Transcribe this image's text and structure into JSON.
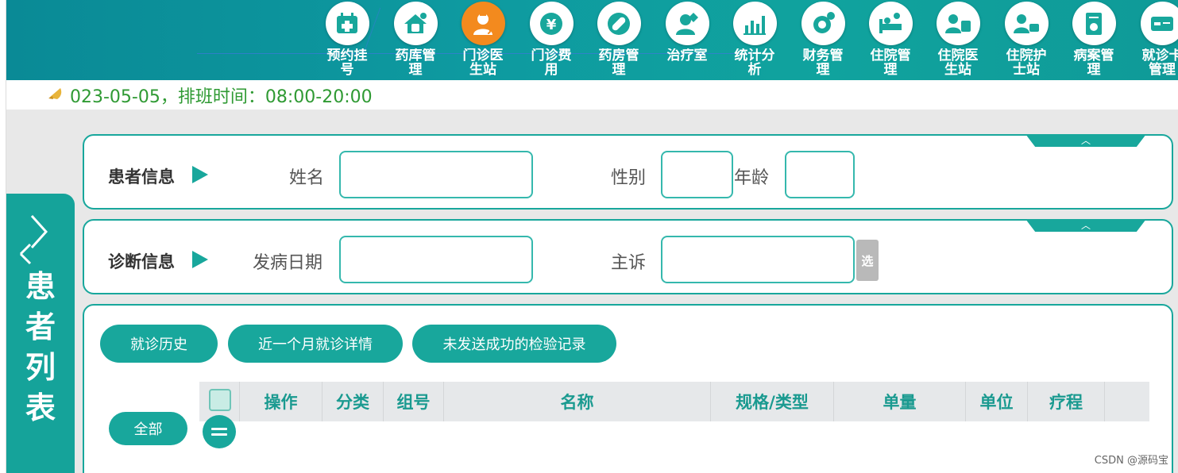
{
  "nav": {
    "items": [
      {
        "label": "预约挂号",
        "icon": "calendar-plus-icon"
      },
      {
        "label": "药库管理",
        "icon": "pharmacy-house-icon"
      },
      {
        "label": "门诊医生站",
        "icon": "doctor-icon",
        "active": true
      },
      {
        "label": "门诊费用",
        "icon": "yuan-coin-icon"
      },
      {
        "label": "药房管理",
        "icon": "pill-icon"
      },
      {
        "label": "治疗室",
        "icon": "nurse-icon"
      },
      {
        "label": "统计分析",
        "icon": "bar-chart-icon"
      },
      {
        "label": "财务管理",
        "icon": "gear-money-icon"
      },
      {
        "label": "住院管理",
        "icon": "hospital-bed-icon"
      },
      {
        "label": "住院医生站",
        "icon": "ward-doctor-icon"
      },
      {
        "label": "住院护士站",
        "icon": "ward-nurse-icon"
      },
      {
        "label": "病案管理",
        "icon": "medical-record-icon"
      },
      {
        "label": "就诊卡管理",
        "icon": "card-icon"
      }
    ]
  },
  "schedule": {
    "text": "023-05-05，排班时间：08:00-20:00"
  },
  "sidebar": {
    "title": "患者列表"
  },
  "patient_panel": {
    "title": "患者信息",
    "name_label": "姓名",
    "gender_label": "性别",
    "age_label": "年龄",
    "name_value": "",
    "gender_value": "",
    "age_value": "",
    "collapse_icon": "chevron-up-icon"
  },
  "diagnosis_panel": {
    "title": "诊断信息",
    "onset_label": "发病日期",
    "complaint_label": "主诉",
    "onset_value": "",
    "complaint_value": "",
    "select_label": "选",
    "collapse_icon": "chevron-up-icon"
  },
  "actions": {
    "history": "就诊历史",
    "month_detail": "近一个月就诊详情",
    "unsent_lab": "未发送成功的检验记录",
    "all": "全部"
  },
  "table": {
    "columns": [
      "操作",
      "分类",
      "组号",
      "名称",
      "规格/类型",
      "单量",
      "单位",
      "疗程"
    ]
  },
  "watermark": "CSDN @源码宝",
  "colors": {
    "primary": "#18a79c",
    "active_nav": "#f38a1e",
    "schedule_text": "#2f9a33"
  }
}
